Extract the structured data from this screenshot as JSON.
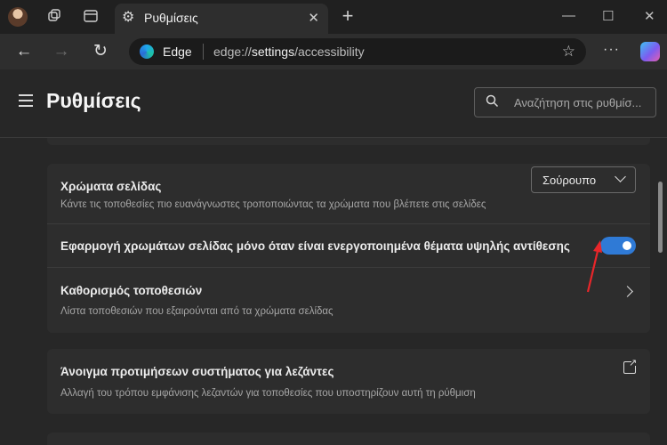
{
  "tab": {
    "title": "Ρυθμίσεις",
    "close_glyph": "✕"
  },
  "window": {
    "minimize": "—",
    "maximize": "☐",
    "close": "✕",
    "new_tab": "+"
  },
  "address_bar": {
    "brand": "Edge",
    "url_prefix": "edge://",
    "url_path": "settings",
    "url_suffix": "/accessibility",
    "more": "···"
  },
  "page": {
    "title": "Ρυθμίσεις"
  },
  "search": {
    "placeholder": "Αναζήτηση στις ρυθμίσ..."
  },
  "settings": {
    "page_colors": {
      "title": "Χρώματα σελίδας",
      "description": "Κάντε τις τοποθεσίες πιο ευανάγνωστες τροποποιώντας τα χρώματα που βλέπετε στις σελίδες",
      "selected_option": "Σούρουπο"
    },
    "high_contrast_only": {
      "title": "Εφαρμογή χρωμάτων σελίδας μόνο όταν είναι ενεργοποιημένα θέματα υψηλής αντίθεσης",
      "enabled": true
    },
    "customize_sites": {
      "title": "Καθορισμός τοποθεσιών",
      "description": "Λίστα τοποθεσιών που εξαιρούνται από τα χρώματα σελίδας"
    },
    "caption_prefs": {
      "title": "Άνοιγμα προτιμήσεων συστήματος για λεζάντες",
      "description": "Αλλαγή του τρόπου εμφάνισης λεζαντών για τοποθεσίες που υποστηρίζουν αυτή τη ρύθμιση"
    }
  },
  "colors": {
    "accent": "#2f7ad6",
    "annotation_arrow": "#e8262a"
  }
}
